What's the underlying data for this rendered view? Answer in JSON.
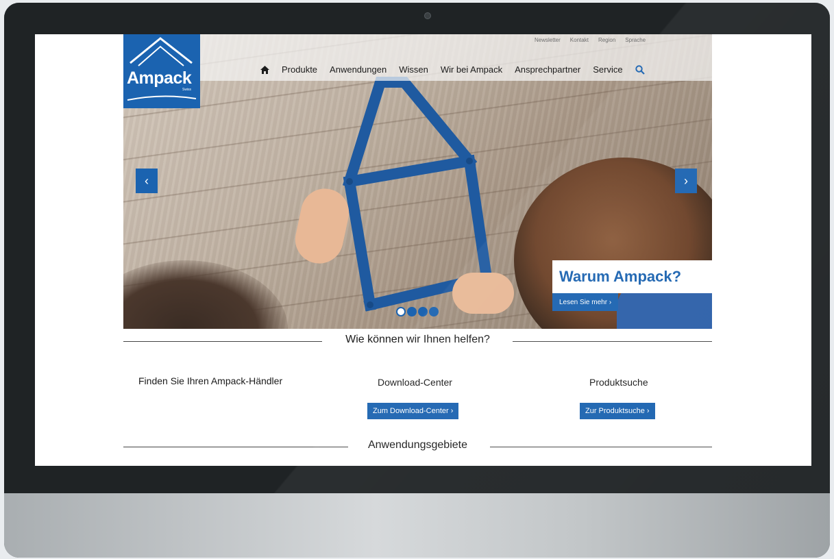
{
  "brand": {
    "name": "Ampack",
    "sub": "Swiss"
  },
  "utility_nav": [
    "Newsletter",
    "Kontakt",
    "Region",
    "Sprache"
  ],
  "main_nav": [
    "Produkte",
    "Anwendungen",
    "Wissen",
    "Wir bei Ampack",
    "Ansprechpartner",
    "Service"
  ],
  "hero": {
    "promo_title": "Warum Ampack?",
    "promo_button": "Lesen Sie mehr ›",
    "prev_arrow": "‹",
    "next_arrow": "›",
    "slides": 4,
    "active_slide": 1
  },
  "help": {
    "heading": "Wie können wir Ihnen helfen?",
    "col1_title": "Finden Sie Ihren Ampack-Händler",
    "col2_title": "Download-Center",
    "col2_button": "Zum Download-Center ›",
    "col3_title": "Produktsuche",
    "col3_button": "Zur Produktsuche ›"
  },
  "areas": {
    "heading": "Anwendungsgebiete"
  },
  "colors": {
    "brand_blue": "#1b63b0",
    "ruler_blue": "#1f5aa0"
  }
}
